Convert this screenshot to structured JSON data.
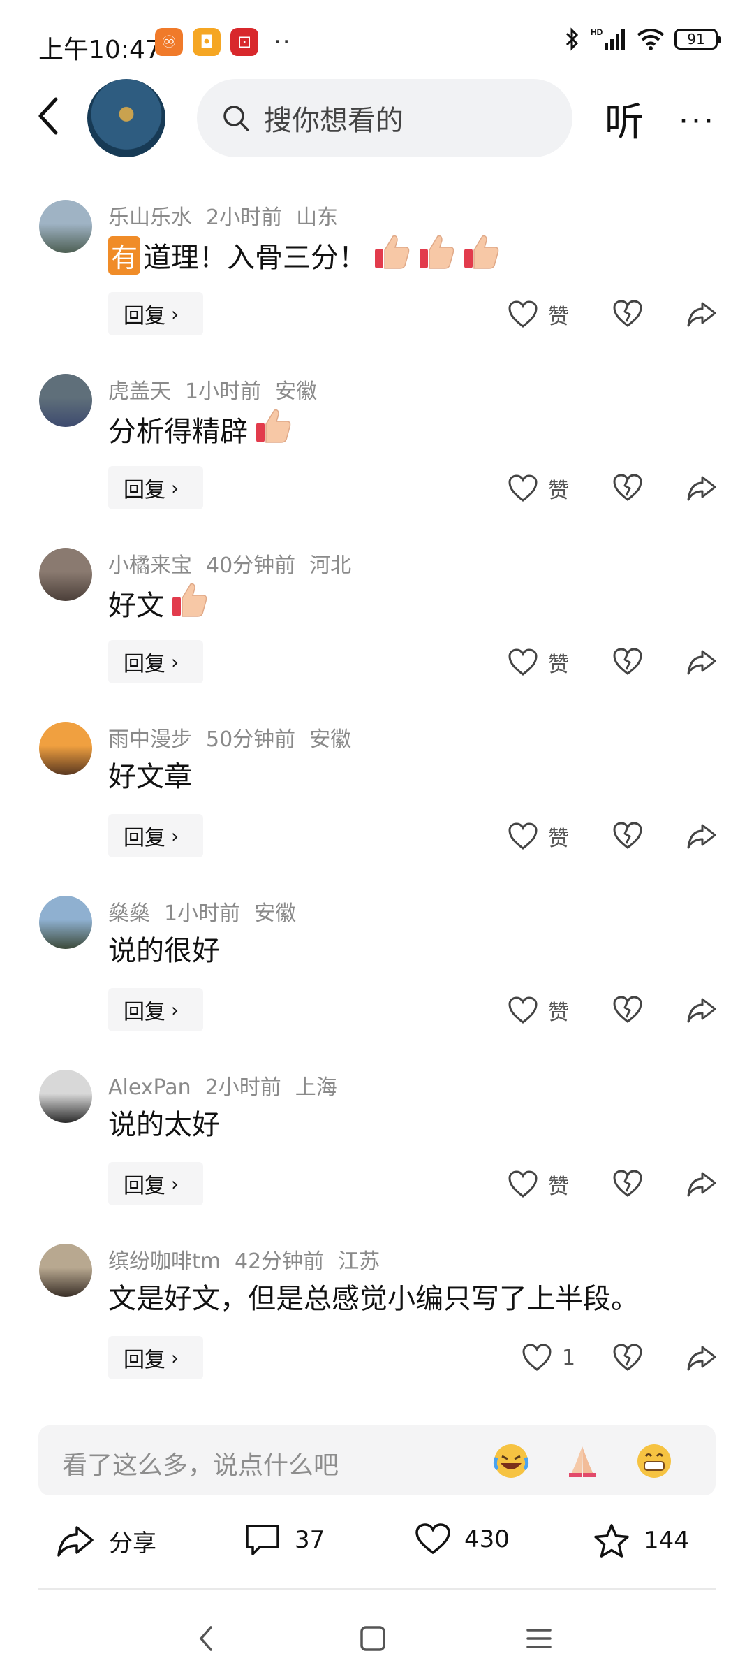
{
  "status_bar": {
    "time": "上午10:47",
    "battery": "91",
    "network": "HD"
  },
  "header": {
    "search_placeholder": "搜你想看的",
    "listen_label": "听",
    "more_label": "···"
  },
  "comments": [
    {
      "user": "乐山乐水",
      "time": "2小时前",
      "location": "山东",
      "text_prefix_tag": "有",
      "text": "道理！入骨三分！",
      "thumbs": 3,
      "reply_label": "回复",
      "like_label": "赞",
      "avatar_colors": [
        "#9fb3c4",
        "#4d5f53"
      ]
    },
    {
      "user": "虎盖天",
      "time": "1小时前",
      "location": "安徽",
      "text": "分析得精辟",
      "thumbs": 1,
      "reply_label": "回复",
      "like_label": "赞",
      "avatar_colors": [
        "#5f6f7a",
        "#3d4a6e"
      ]
    },
    {
      "user": "小橘来宝",
      "time": "40分钟前",
      "location": "河北",
      "text": "好文",
      "thumbs": 1,
      "reply_label": "回复",
      "like_label": "赞",
      "avatar_colors": [
        "#8a7a70",
        "#4b3f39"
      ]
    },
    {
      "user": "雨中漫步",
      "time": "50分钟前",
      "location": "安徽",
      "text": "好文章",
      "thumbs": 0,
      "reply_label": "回复",
      "like_label": "赞",
      "avatar_colors": [
        "#f0a040",
        "#5a3820"
      ]
    },
    {
      "user": "燊燊",
      "time": "1小时前",
      "location": "安徽",
      "text": "说的很好",
      "thumbs": 0,
      "reply_label": "回复",
      "like_label": "赞",
      "avatar_colors": [
        "#8fb0d0",
        "#3c4a3a"
      ]
    },
    {
      "user": "AlexPan",
      "time": "2小时前",
      "location": "上海",
      "text": "说的太好",
      "thumbs": 0,
      "reply_label": "回复",
      "like_label": "赞",
      "avatar_colors": [
        "#d8d8d8",
        "#2a2a2a"
      ]
    },
    {
      "user": "缤纷咖啡tm",
      "time": "42分钟前",
      "location": "江苏",
      "text": "文是好文，但是总感觉小编只写了上半段。",
      "thumbs": 0,
      "reply_label": "回复",
      "like_label": "1",
      "avatar_colors": [
        "#b8a890",
        "#3a3028"
      ]
    }
  ],
  "input_bar": {
    "placeholder": "看了这么多，说点什么吧"
  },
  "bottom_bar": {
    "share_label": "分享",
    "comments_count": "37",
    "likes_count": "430",
    "favorites_count": "144"
  },
  "colors": {
    "accent_orange": "#f08c28",
    "thumb_red": "#e23b4c"
  }
}
